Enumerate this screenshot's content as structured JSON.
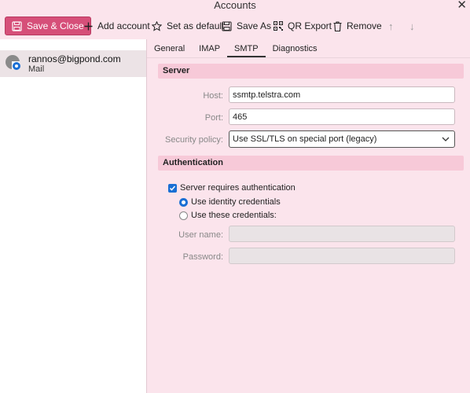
{
  "window": {
    "title": "Accounts",
    "close_glyph": "✕"
  },
  "toolbar": {
    "save_close": "Save & Close",
    "add_account": "Add account",
    "set_default": "Set as default",
    "save_as": "Save As",
    "qr_export": "QR Export",
    "remove": "Remove",
    "move_up": "↑",
    "move_down": "↓"
  },
  "sidebar": {
    "account": {
      "name": "rannos@bigpond.com",
      "type": "Mail"
    }
  },
  "tabs": [
    "General",
    "IMAP",
    "SMTP",
    "Diagnostics"
  ],
  "active_tab": "SMTP",
  "server": {
    "section_title": "Server",
    "host_label": "Host:",
    "host_value": "ssmtp.telstra.com",
    "port_label": "Port:",
    "port_value": "465",
    "security_label": "Security policy:",
    "security_value": "Use SSL/TLS on special port (legacy)"
  },
  "auth": {
    "section_title": "Authentication",
    "requires_auth_label": "Server requires authentication",
    "requires_auth_checked": true,
    "use_identity_label": "Use identity credentials",
    "use_these_label": "Use these credentials:",
    "selected": "identity",
    "username_label": "User name:",
    "username_value": "",
    "password_label": "Password:",
    "password_value": ""
  },
  "colors": {
    "accent": "#d64f79",
    "selection": "#1a6fd4",
    "background": "#fbe4ec",
    "section": "#f7c9d8"
  }
}
